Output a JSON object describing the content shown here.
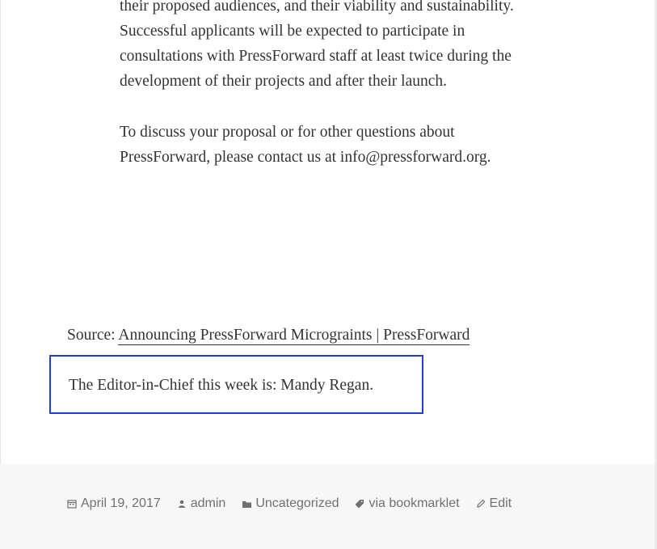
{
  "article": {
    "paragraphs": [
      "their proposed audiences, and their viability and sustainability. Successful applicants will be expected to participate in consultations with PressForward staff at least twice during the development of their projects and after their launch.",
      "To discuss your proposal or for other questions about PressForward, please contact us at info@pressforward.org."
    ],
    "source_prefix": "Source: ",
    "source_link": "Announcing PressForward Micrograints | PressForward",
    "editor_note": "The Editor-in-Chief this week is: Mandy Regan."
  },
  "meta": {
    "date": "April 19, 2017",
    "author": "admin",
    "category": "Uncategorized",
    "tag": "via bookmarklet",
    "edit": "Edit"
  },
  "colors": {
    "highlight_border": "#1f3fd6",
    "text": "#333333",
    "meta_text": "#707070"
  },
  "icons": {
    "date": "calendar-icon",
    "author": "person-icon",
    "category": "folder-icon",
    "tag": "tag-icon",
    "edit": "pencil-icon"
  }
}
